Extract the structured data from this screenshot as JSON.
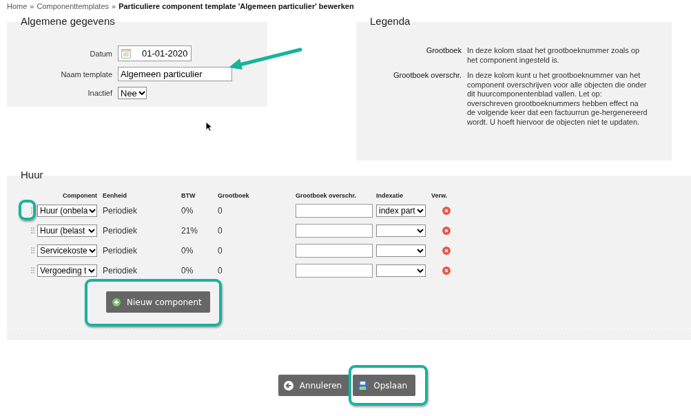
{
  "breadcrumb": {
    "separator": "»",
    "items": [
      {
        "label": "Home",
        "current": false
      },
      {
        "label": "Componenttemplates",
        "current": false
      },
      {
        "label": "Particuliere component template 'Algemeen particulier' bewerken",
        "current": true
      }
    ]
  },
  "general": {
    "title": "Algemene gegevens",
    "fields": [
      {
        "kind": "date",
        "label": "Datum",
        "value": "01-01-2020"
      },
      {
        "kind": "text",
        "label": "Naam template",
        "value": "Algemeen particulier"
      },
      {
        "kind": "select",
        "label": "Inactief",
        "value": "Nee"
      }
    ]
  },
  "legend": {
    "title": "Legenda",
    "entries": [
      {
        "term": "Grootboek",
        "description": "In deze kolom staat het grootboeknummer zoals op het component ingesteld is."
      },
      {
        "term": "Grootboek overschr.",
        "description": "In deze kolom kunt u het grootboeknummer van het component overschrijven voor alle objecten die onder dit huurcomponentenblad vallen. Let op: overschreven grootboeknummers hebben effect na de volgende keer dat een factuurrun ge-hergenereerd wordt. U hoeft hiervoor de objecten niet te updaten."
      }
    ]
  },
  "rent": {
    "title": "Huur",
    "columns": [
      "Component",
      "Eenheid",
      "BTW",
      "Grootboek",
      "Grootboek overschr.",
      "Indexatie",
      "Verw."
    ],
    "rows": [
      {
        "component": "Huur (onbela",
        "unit": "Periodiek",
        "vat": "0%",
        "ledger": "0",
        "indexation": "index part"
      },
      {
        "component": "Huur (belast",
        "unit": "Periodiek",
        "vat": "21%",
        "ledger": "0"
      },
      {
        "component": "Servicekoste",
        "unit": "Periodiek",
        "vat": "0%",
        "ledger": "0"
      },
      {
        "component": "Vergoeding t",
        "unit": "Periodiek",
        "vat": "0%",
        "ledger": "0"
      }
    ],
    "add_button": "Nieuw component"
  },
  "buttons": [
    {
      "kind": "cancel",
      "label": "Annuleren"
    },
    {
      "kind": "save",
      "label": "Opslaan"
    }
  ]
}
